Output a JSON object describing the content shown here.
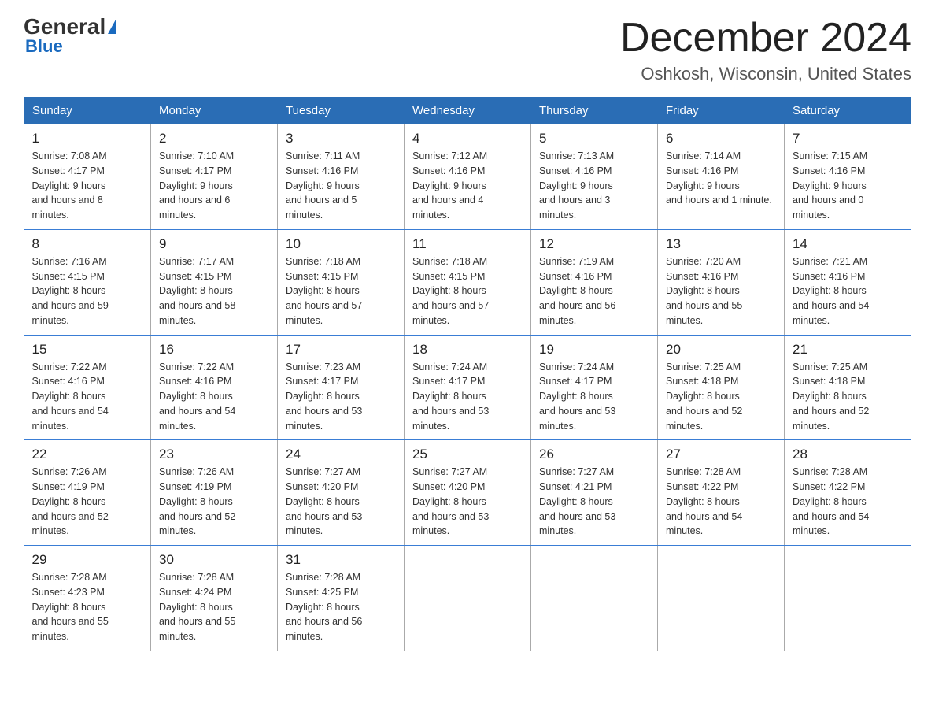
{
  "header": {
    "logo_general": "General",
    "logo_blue": "Blue",
    "month_title": "December 2024",
    "location": "Oshkosh, Wisconsin, United States"
  },
  "days_of_week": [
    "Sunday",
    "Monday",
    "Tuesday",
    "Wednesday",
    "Thursday",
    "Friday",
    "Saturday"
  ],
  "weeks": [
    [
      {
        "day": "1",
        "sunrise": "7:08 AM",
        "sunset": "4:17 PM",
        "daylight": "9 hours and 8 minutes."
      },
      {
        "day": "2",
        "sunrise": "7:10 AM",
        "sunset": "4:17 PM",
        "daylight": "9 hours and 6 minutes."
      },
      {
        "day": "3",
        "sunrise": "7:11 AM",
        "sunset": "4:16 PM",
        "daylight": "9 hours and 5 minutes."
      },
      {
        "day": "4",
        "sunrise": "7:12 AM",
        "sunset": "4:16 PM",
        "daylight": "9 hours and 4 minutes."
      },
      {
        "day": "5",
        "sunrise": "7:13 AM",
        "sunset": "4:16 PM",
        "daylight": "9 hours and 3 minutes."
      },
      {
        "day": "6",
        "sunrise": "7:14 AM",
        "sunset": "4:16 PM",
        "daylight": "9 hours and 1 minute."
      },
      {
        "day": "7",
        "sunrise": "7:15 AM",
        "sunset": "4:16 PM",
        "daylight": "9 hours and 0 minutes."
      }
    ],
    [
      {
        "day": "8",
        "sunrise": "7:16 AM",
        "sunset": "4:15 PM",
        "daylight": "8 hours and 59 minutes."
      },
      {
        "day": "9",
        "sunrise": "7:17 AM",
        "sunset": "4:15 PM",
        "daylight": "8 hours and 58 minutes."
      },
      {
        "day": "10",
        "sunrise": "7:18 AM",
        "sunset": "4:15 PM",
        "daylight": "8 hours and 57 minutes."
      },
      {
        "day": "11",
        "sunrise": "7:18 AM",
        "sunset": "4:15 PM",
        "daylight": "8 hours and 57 minutes."
      },
      {
        "day": "12",
        "sunrise": "7:19 AM",
        "sunset": "4:16 PM",
        "daylight": "8 hours and 56 minutes."
      },
      {
        "day": "13",
        "sunrise": "7:20 AM",
        "sunset": "4:16 PM",
        "daylight": "8 hours and 55 minutes."
      },
      {
        "day": "14",
        "sunrise": "7:21 AM",
        "sunset": "4:16 PM",
        "daylight": "8 hours and 54 minutes."
      }
    ],
    [
      {
        "day": "15",
        "sunrise": "7:22 AM",
        "sunset": "4:16 PM",
        "daylight": "8 hours and 54 minutes."
      },
      {
        "day": "16",
        "sunrise": "7:22 AM",
        "sunset": "4:16 PM",
        "daylight": "8 hours and 54 minutes."
      },
      {
        "day": "17",
        "sunrise": "7:23 AM",
        "sunset": "4:17 PM",
        "daylight": "8 hours and 53 minutes."
      },
      {
        "day": "18",
        "sunrise": "7:24 AM",
        "sunset": "4:17 PM",
        "daylight": "8 hours and 53 minutes."
      },
      {
        "day": "19",
        "sunrise": "7:24 AM",
        "sunset": "4:17 PM",
        "daylight": "8 hours and 53 minutes."
      },
      {
        "day": "20",
        "sunrise": "7:25 AM",
        "sunset": "4:18 PM",
        "daylight": "8 hours and 52 minutes."
      },
      {
        "day": "21",
        "sunrise": "7:25 AM",
        "sunset": "4:18 PM",
        "daylight": "8 hours and 52 minutes."
      }
    ],
    [
      {
        "day": "22",
        "sunrise": "7:26 AM",
        "sunset": "4:19 PM",
        "daylight": "8 hours and 52 minutes."
      },
      {
        "day": "23",
        "sunrise": "7:26 AM",
        "sunset": "4:19 PM",
        "daylight": "8 hours and 52 minutes."
      },
      {
        "day": "24",
        "sunrise": "7:27 AM",
        "sunset": "4:20 PM",
        "daylight": "8 hours and 53 minutes."
      },
      {
        "day": "25",
        "sunrise": "7:27 AM",
        "sunset": "4:20 PM",
        "daylight": "8 hours and 53 minutes."
      },
      {
        "day": "26",
        "sunrise": "7:27 AM",
        "sunset": "4:21 PM",
        "daylight": "8 hours and 53 minutes."
      },
      {
        "day": "27",
        "sunrise": "7:28 AM",
        "sunset": "4:22 PM",
        "daylight": "8 hours and 54 minutes."
      },
      {
        "day": "28",
        "sunrise": "7:28 AM",
        "sunset": "4:22 PM",
        "daylight": "8 hours and 54 minutes."
      }
    ],
    [
      {
        "day": "29",
        "sunrise": "7:28 AM",
        "sunset": "4:23 PM",
        "daylight": "8 hours and 55 minutes."
      },
      {
        "day": "30",
        "sunrise": "7:28 AM",
        "sunset": "4:24 PM",
        "daylight": "8 hours and 55 minutes."
      },
      {
        "day": "31",
        "sunrise": "7:28 AM",
        "sunset": "4:25 PM",
        "daylight": "8 hours and 56 minutes."
      },
      null,
      null,
      null,
      null
    ]
  ],
  "labels": {
    "sunrise_prefix": "Sunrise: ",
    "sunset_prefix": "Sunset: ",
    "daylight_prefix": "Daylight: "
  }
}
